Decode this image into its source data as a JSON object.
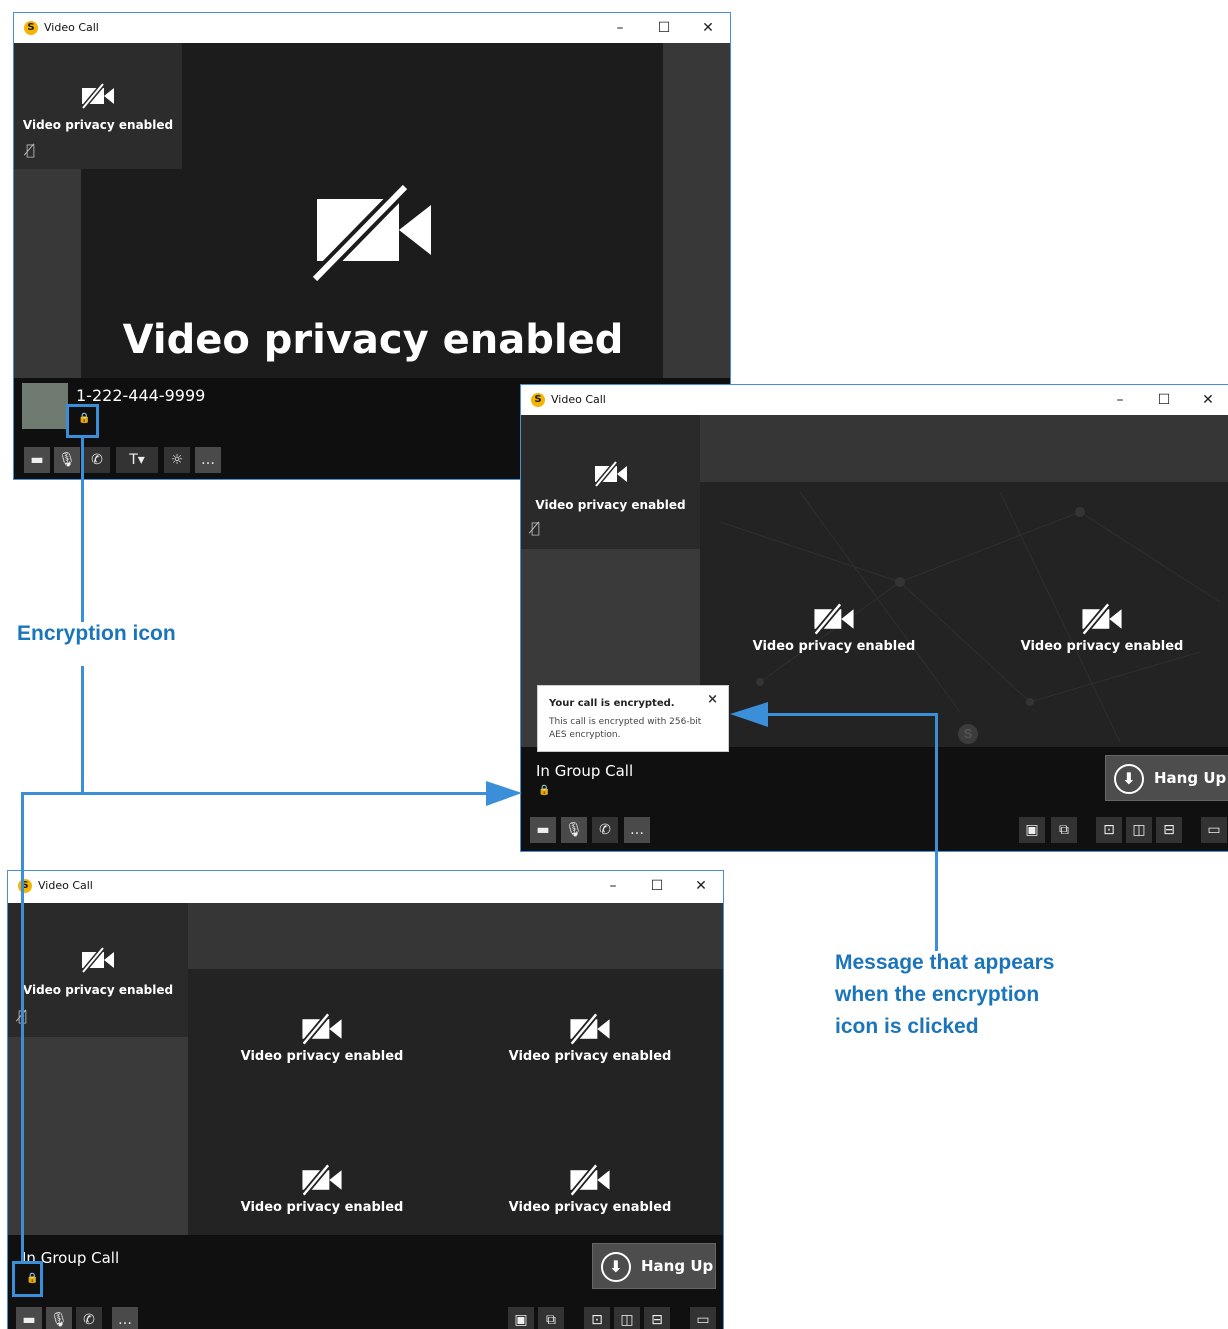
{
  "window_title": "Video Call",
  "app_logo_glyph": "S",
  "window_controls": {
    "minimize": "–",
    "maximize": "☐",
    "close": "✕"
  },
  "video_privacy_label": "Video privacy enabled",
  "window1": {
    "caller_number": "1-222-444-9999",
    "main_label": "Video privacy enabled"
  },
  "group_call_label": "In Group Call",
  "hang_up_label": "Hang Up",
  "tooltip": {
    "title": "Your call is encrypted.",
    "body": "This call is encrypted with 256-bit AES encryption.",
    "close": "×"
  },
  "annotations": {
    "encryption_icon": "Encryption icon",
    "message": [
      "Message that appears",
      "when the encryption",
      "icon is clicked"
    ]
  },
  "colors": {
    "annotation": "#1b75bb",
    "highlight": "#3a8fd8",
    "lock": "#f2b200",
    "call_bg": "#232323"
  },
  "icons": [
    "camera-off-icon",
    "mic-off-icon",
    "phone-icon",
    "text-icon",
    "brightness-icon",
    "more-icon",
    "lock-icon",
    "hang-up-icon",
    "layout-icon"
  ]
}
